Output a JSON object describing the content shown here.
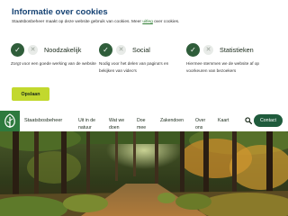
{
  "cookie": {
    "title": "Informatie over cookies",
    "intro_text": "Staatsbosbeheer maakt op deze website gebruik van cookies. Meer ",
    "intro_link": "uitleg",
    "intro_end": " over cookies.",
    "options": [
      {
        "label": "Noodzakelijk",
        "description": "Zorgt voor een goede werking van de website"
      },
      {
        "label": "Social",
        "description": "Nodig voor het delen van pagina's en bekijken van video's"
      },
      {
        "label": "Statistieken",
        "description": "Hiermee stemmen we de website af op voorkeuren van bezoekers"
      }
    ],
    "save_label": "Opslaan"
  },
  "nav": {
    "brand": "Staatsbosbeheer",
    "items": [
      {
        "label": "Uit in de natuur"
      },
      {
        "label": "Wat we doen"
      },
      {
        "label": "Doe mee"
      },
      {
        "label": "Zakendoen"
      },
      {
        "label": "Over ons"
      },
      {
        "label": "Kaart"
      }
    ],
    "contact_label": "Contact"
  },
  "icons": {
    "checked": "check-icon",
    "unchecked": "close-icon",
    "search": "search-icon",
    "logo": "tree-logo-icon"
  },
  "colors": {
    "title": "#154273",
    "check_active": "#2f5d3a",
    "save_button": "#c2d82e",
    "contact_button": "#1f5b3c",
    "logo_bg": "#2e7a3e"
  }
}
